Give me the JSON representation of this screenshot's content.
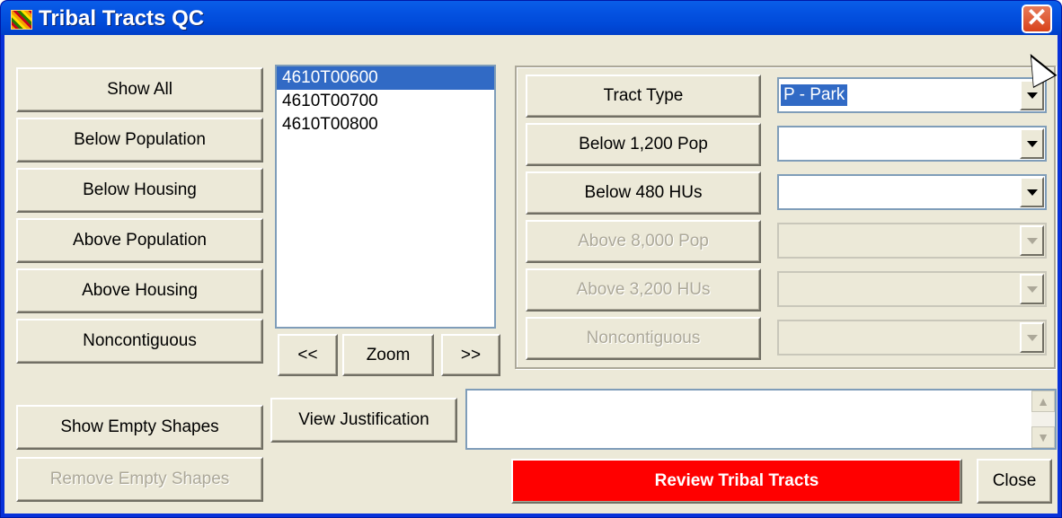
{
  "window": {
    "title": "Tribal Tracts QC",
    "close_glyph": "✕",
    "icon": "app-icon"
  },
  "left_buttons": {
    "show_all": "Show All",
    "below_population": "Below Population",
    "below_housing": "Below Housing",
    "above_population": "Above Population",
    "above_housing": "Above Housing",
    "noncontiguous": "Noncontiguous",
    "show_empty_shapes": "Show Empty Shapes",
    "remove_empty_shapes": "Remove Empty Shapes"
  },
  "tract_list": {
    "items": [
      "4610T00600",
      "4610T00700",
      "4610T00800"
    ],
    "selected_index": 0
  },
  "nav": {
    "prev": "<<",
    "zoom": "Zoom",
    "next": ">>"
  },
  "criteria": {
    "tract_type_label": "Tract Type",
    "tract_type_value": "P - Park",
    "below_pop_label": "Below 1,200 Pop",
    "below_hu_label": "Below 480 HUs",
    "above_pop_label": "Above 8,000 Pop",
    "above_hu_label": "Above 3,200 HUs",
    "noncontiguous_label": "Noncontiguous"
  },
  "justification": {
    "view_label": "View Justification",
    "text": ""
  },
  "footer": {
    "review_label": "Review Tribal Tracts",
    "close_label": "Close"
  },
  "colors": {
    "review_button": "#ff0000",
    "selection": "#316ac5",
    "title_bar": "#0054e3"
  }
}
